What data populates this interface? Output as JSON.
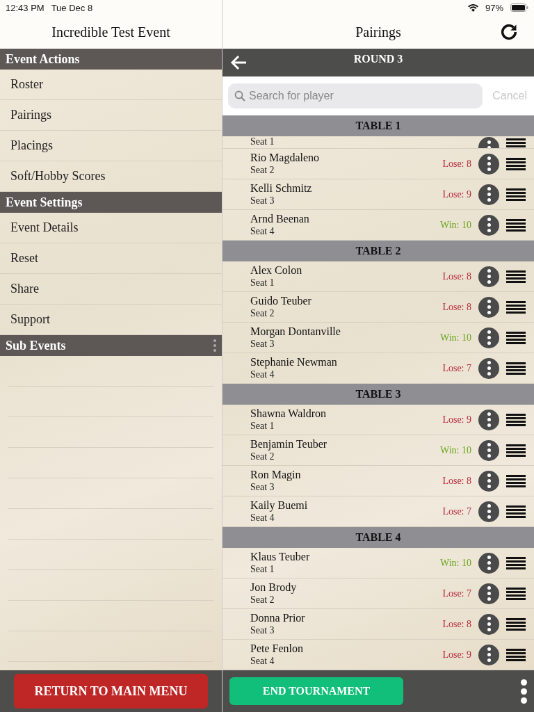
{
  "status_bar": {
    "time": "12:43 PM",
    "date": "Tue Dec 8",
    "battery": "97%"
  },
  "sidebar": {
    "title": "Incredible Test Event",
    "sections": [
      {
        "title": "Event Actions",
        "menu": false,
        "items": [
          "Roster",
          "Pairings",
          "Placings",
          "Soft/Hobby Scores"
        ]
      },
      {
        "title": "Event Settings",
        "menu": false,
        "items": [
          "Event Details",
          "Reset",
          "Share",
          "Support"
        ]
      },
      {
        "title": "Sub Events",
        "menu": true
      }
    ],
    "button": "RETURN TO MAIN MENU"
  },
  "main": {
    "title": "Pairings",
    "round": "ROUND 3",
    "search": {
      "placeholder": "Search for player",
      "cancel": "Cancel"
    },
    "tables": [
      {
        "title": "TABLE 1",
        "players": [
          {
            "seat": "Seat 1"
          },
          {
            "name": "Rio Magdaleno",
            "seat": "Seat 2",
            "result": "Lose: 8",
            "color": "#b5283a"
          },
          {
            "name": "Kelli Schmitz",
            "seat": "Seat 3",
            "result": "Lose: 9",
            "color": "#b5283a"
          },
          {
            "name": "Arnd Beenan",
            "seat": "Seat 4",
            "result": "Win: 10",
            "color": "#6aa51d"
          }
        ]
      },
      {
        "title": "TABLE 2",
        "players": [
          {
            "name": "Alex Colon",
            "seat": "Seat 1",
            "result": "Lose: 8",
            "color": "#b5283a"
          },
          {
            "name": "Guido Teuber",
            "seat": "Seat 2",
            "result": "Lose: 8",
            "color": "#b5283a"
          },
          {
            "name": "Morgan Dontanville",
            "seat": "Seat 3",
            "result": "Win: 10",
            "color": "#6aa51d"
          },
          {
            "name": "Stephanie Newman",
            "seat": "Seat 4",
            "result": "Lose: 7",
            "color": "#b5283a"
          }
        ]
      },
      {
        "title": "TABLE 3",
        "players": [
          {
            "name": "Shawna Waldron",
            "seat": "Seat 1",
            "result": "Lose: 9",
            "color": "#b5283a"
          },
          {
            "name": "Benjamin Teuber",
            "seat": "Seat 2",
            "result": "Win: 10",
            "color": "#6aa51d"
          },
          {
            "name": "Ron Magin",
            "seat": "Seat 3",
            "result": "Lose: 8",
            "color": "#b5283a"
          },
          {
            "name": "Kaily Buemi",
            "seat": "Seat 4",
            "result": "Lose: 7",
            "color": "#b5283a"
          }
        ]
      },
      {
        "title": "TABLE 4",
        "players": [
          {
            "name": "Klaus Teuber",
            "seat": "Seat 1",
            "result": "Win: 10",
            "color": "#6aa51d"
          },
          {
            "name": "Jon Brody",
            "seat": "Seat 2",
            "result": "Lose: 7",
            "color": "#b5283a"
          },
          {
            "name": "Donna Prior",
            "seat": "Seat 3",
            "result": "Lose: 8",
            "color": "#b5283a"
          },
          {
            "name": "Pete Fenlon",
            "seat": "Seat 4",
            "result": "Lose: 9",
            "color": "#b5283a"
          }
        ]
      }
    ],
    "button": "END TOURNAMENT"
  }
}
